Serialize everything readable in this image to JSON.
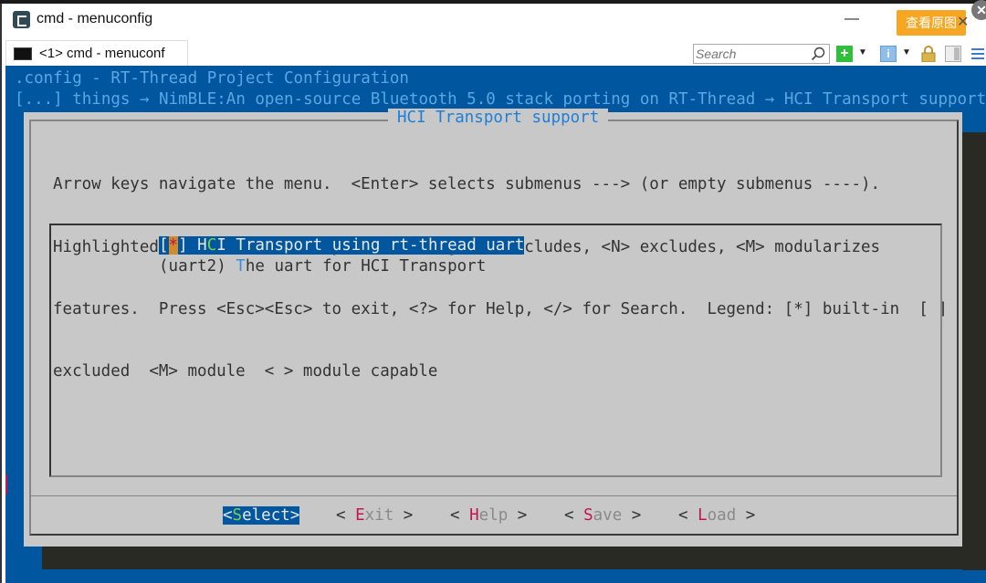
{
  "window": {
    "title": "cmd - menuconfig",
    "minimize_glyph": "—",
    "view_original_label": "查看原图",
    "close_glyph": "✕",
    "overlay_close_glyph": "✕"
  },
  "tabbar": {
    "tabs": [
      {
        "label": "<1> cmd - menuconf"
      }
    ],
    "search": {
      "placeholder": "Search",
      "value": ""
    },
    "icons": [
      "search-icon",
      "add-icon",
      "dropdown-icon",
      "info-icon",
      "dropdown-icon",
      "lock-icon",
      "panel-icon",
      "menu-icon"
    ]
  },
  "console": {
    "config_title": ".config - RT-Thread Project Configuration",
    "breadcrumb": "[...] things → NimBLE:An open-source Bluetooth 5.0 stack porting on RT-Thread → HCI Transport support",
    "dialog": {
      "title": "HCI Transport support",
      "help_lines": [
        "Arrow keys navigate the menu.  <Enter> selects submenus ---> (or empty submenus ----).",
        "Highlighted letters are hotkeys.  Pressing <Y> includes, <N> excludes, <M> modularizes",
        "features.  Press <Esc><Esc> to exit, <?> for Help, </> for Search.  Legend: [*] built-in  [ ]",
        "excluded  <M> module  < > module capable"
      ],
      "items": [
        {
          "prefix_open": "[",
          "state": "*",
          "prefix_close": "] ",
          "pre": "H",
          "hotkey": "C",
          "rest": "I Transport using rt-thread uart",
          "selected": true
        },
        {
          "prefix": "(uart2) ",
          "hotkey": "T",
          "rest": "he uart for HCI Transport",
          "selected": false
        }
      ],
      "buttons": [
        {
          "open": "<",
          "hotkey": "S",
          "rest": "elect",
          "close": ">",
          "selected": true
        },
        {
          "open": "< ",
          "hotkey": "E",
          "rest": "xit",
          "close": " >",
          "selected": false
        },
        {
          "open": "< ",
          "hotkey": "H",
          "rest": "elp",
          "close": " >",
          "selected": false
        },
        {
          "open": "< ",
          "hotkey": "S",
          "rest": "ave",
          "close": " >",
          "selected": false
        },
        {
          "open": "< ",
          "hotkey": "L",
          "rest": "oad",
          "close": " >",
          "selected": false
        }
      ]
    }
  },
  "colors": {
    "console_bg": "#0156a0",
    "dialog_bg": "#c8c8c8",
    "title_blue": "#1e7fd8",
    "hotkey_red": "#c0174f",
    "hotkey_green": "#7bd04a",
    "cursor_orange": "#d48a2a",
    "view_original_orange": "#f5a623"
  }
}
